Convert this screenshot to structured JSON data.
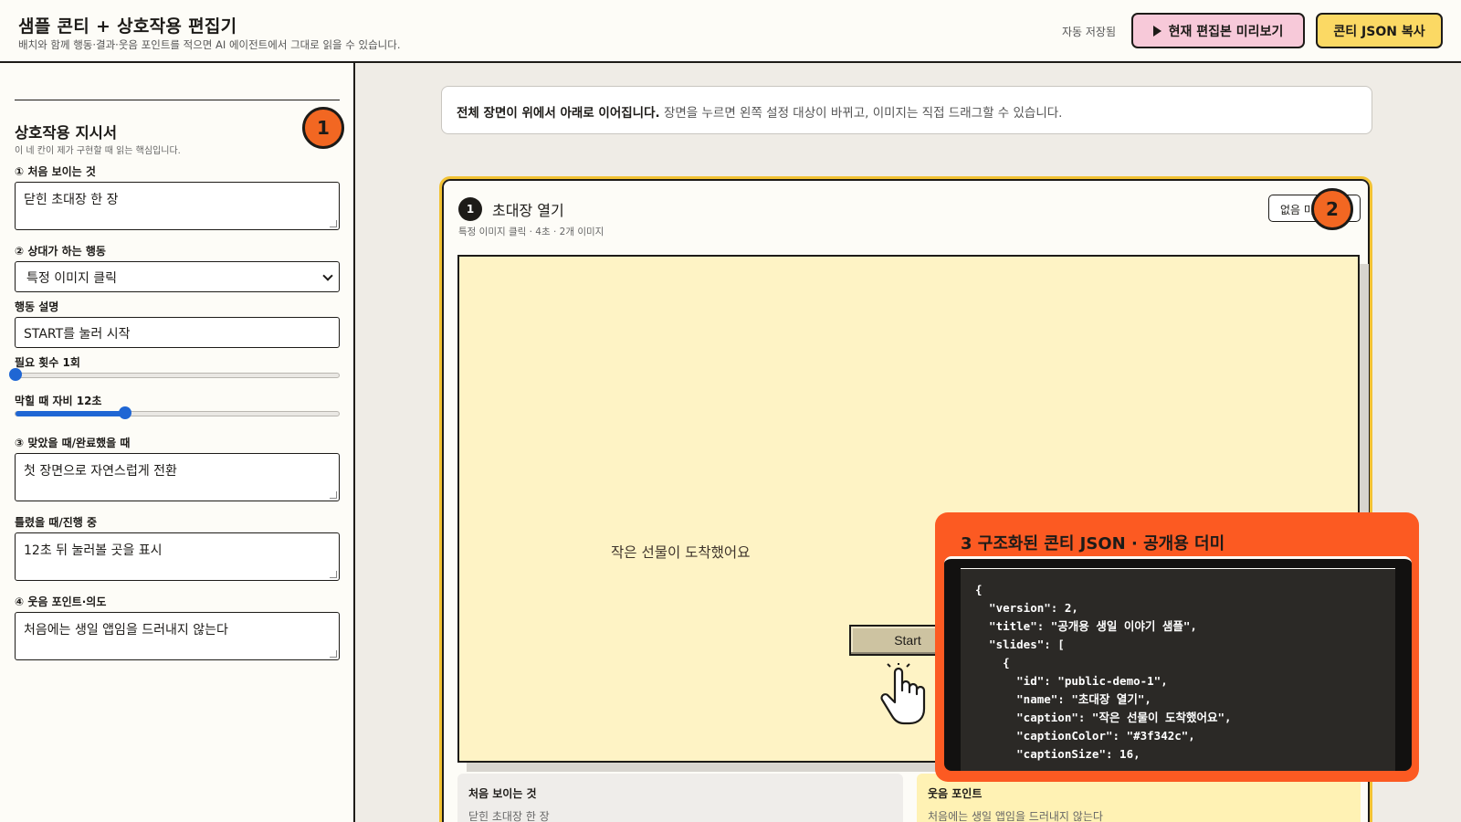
{
  "header": {
    "title": "샘플 콘티 + 상호작용 편집기",
    "subtitle": "배치와 함께 행동·결과·웃음 포인트를 적으면 AI 에이전트에서 그대로 읽을 수 있습니다.",
    "autosave": "자동 저장됨",
    "preview_label": "현재 편집본 미리보기",
    "copy_label": "콘티 JSON 복사"
  },
  "sidebar": {
    "section_title": "상호작용 지시서",
    "section_sub": "이 네 칸이 제가 구현할 때 읽는 핵심입니다.",
    "badge": "1",
    "first_seen_label": "① 처음 보이는 것",
    "first_seen_value": "닫힌 초대장 한 장",
    "action_label": "② 상대가 하는 행동",
    "action_value": "특정 이미지 클릭",
    "action_desc_label": "행동 설명",
    "action_desc_value": "START를 눌러 시작",
    "count_label": "필요 횟수 1회",
    "count_fraction": 0.0,
    "hint_label": "막힐 때 자비 12초",
    "hint_fraction": 0.34,
    "success_label": "③ 맞았을 때/완료했을 때",
    "success_value": "첫 장면으로 자연스럽게 전환",
    "fail_label": "틀렸을 때/진행 중",
    "fail_value": "12초 뒤 눌러볼 곳을 표시",
    "humor_label": "④ 웃음 포인트·의도",
    "humor_value": "처음에는 생일 앱임을 드러내지 않는다"
  },
  "main": {
    "notice_bold": "전체 장면이 위에서 아래로 이어집니다.",
    "notice_rest": " 장면을 누르면 왼쪽 설정 대상이 바뀌고, 이미지는 직접 드래그할 수 있습니다.",
    "scene": {
      "number": "1",
      "name": "초대장 열기",
      "meta": "특정 이미지 클릭 · 4초 · 2개 이미지",
      "button_label": "없음 미",
      "badge": "2",
      "caption": "작은 선물이 도착했어요",
      "start_label": "Start",
      "note_left_title": "처음 보이는 것",
      "note_left_text": "닫힌 초대장 한 장",
      "note_right_title": "웃음 포인트",
      "note_right_text": "처음에는 생일 앱임을 드러내지 않는다"
    },
    "json_panel": {
      "title": "3 구조화된 콘티 JSON · 공개용 더미",
      "lines": [
        "{",
        "  \"version\": 2,",
        "  \"title\": \"공개용 생일 이야기 샘플\",",
        "  \"slides\": [",
        "    {",
        "      \"id\": \"public-demo-1\",",
        "      \"name\": \"초대장 열기\",",
        "      \"caption\": \"작은 선물이 도착했어요\",",
        "      \"captionColor\": \"#3f342c\",",
        "      \"captionSize\": 16,"
      ]
    }
  },
  "colors": {
    "accent_orange": "#f26722",
    "preview_pink": "#f7c9d9",
    "copy_yellow": "#fbd964",
    "stage_bg": "#fef3c5",
    "slider_blue": "#1f66d4"
  }
}
